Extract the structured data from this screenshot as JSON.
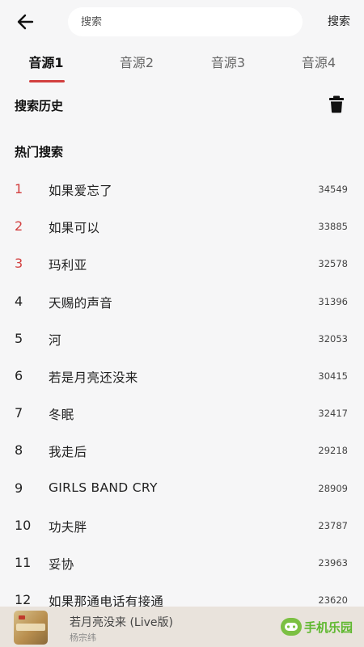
{
  "header": {
    "search_placeholder": "搜索",
    "search_action": "搜索"
  },
  "tabs": [
    {
      "label": "音源1",
      "active": true
    },
    {
      "label": "音源2",
      "active": false
    },
    {
      "label": "音源3",
      "active": false
    },
    {
      "label": "音源4",
      "active": false
    }
  ],
  "history": {
    "title": "搜索历史"
  },
  "hot": {
    "title": "热门搜索",
    "items": [
      {
        "rank": "1",
        "name": "如果爱忘了",
        "count": "34549"
      },
      {
        "rank": "2",
        "name": "如果可以",
        "count": "33885"
      },
      {
        "rank": "3",
        "name": "玛利亚",
        "count": "32578"
      },
      {
        "rank": "4",
        "name": "天赐的声音",
        "count": "31396"
      },
      {
        "rank": "5",
        "name": "河",
        "count": "32053"
      },
      {
        "rank": "6",
        "name": "若是月亮还没来",
        "count": "30415"
      },
      {
        "rank": "7",
        "name": "冬眠",
        "count": "32417"
      },
      {
        "rank": "8",
        "name": "我走后",
        "count": "29218"
      },
      {
        "rank": "9",
        "name": "GIRLS BAND CRY",
        "count": "28909"
      },
      {
        "rank": "10",
        "name": "功夫胖",
        "count": "23787"
      },
      {
        "rank": "11",
        "name": "妥协",
        "count": "23963"
      },
      {
        "rank": "12",
        "name": "如果那通电话有接通",
        "count": "23620"
      }
    ]
  },
  "player": {
    "title": "若月亮没来 (Live版)",
    "artist": "杨宗纬"
  },
  "watermark": {
    "text": "手机乐园"
  },
  "colors": {
    "accent": "#d23f3f",
    "background": "#f6f6f7",
    "player_bg": "#e9e3dc",
    "watermark_green": "#5fb82f"
  },
  "icons": {
    "back": "arrow-left-icon",
    "trash": "trash-icon"
  }
}
